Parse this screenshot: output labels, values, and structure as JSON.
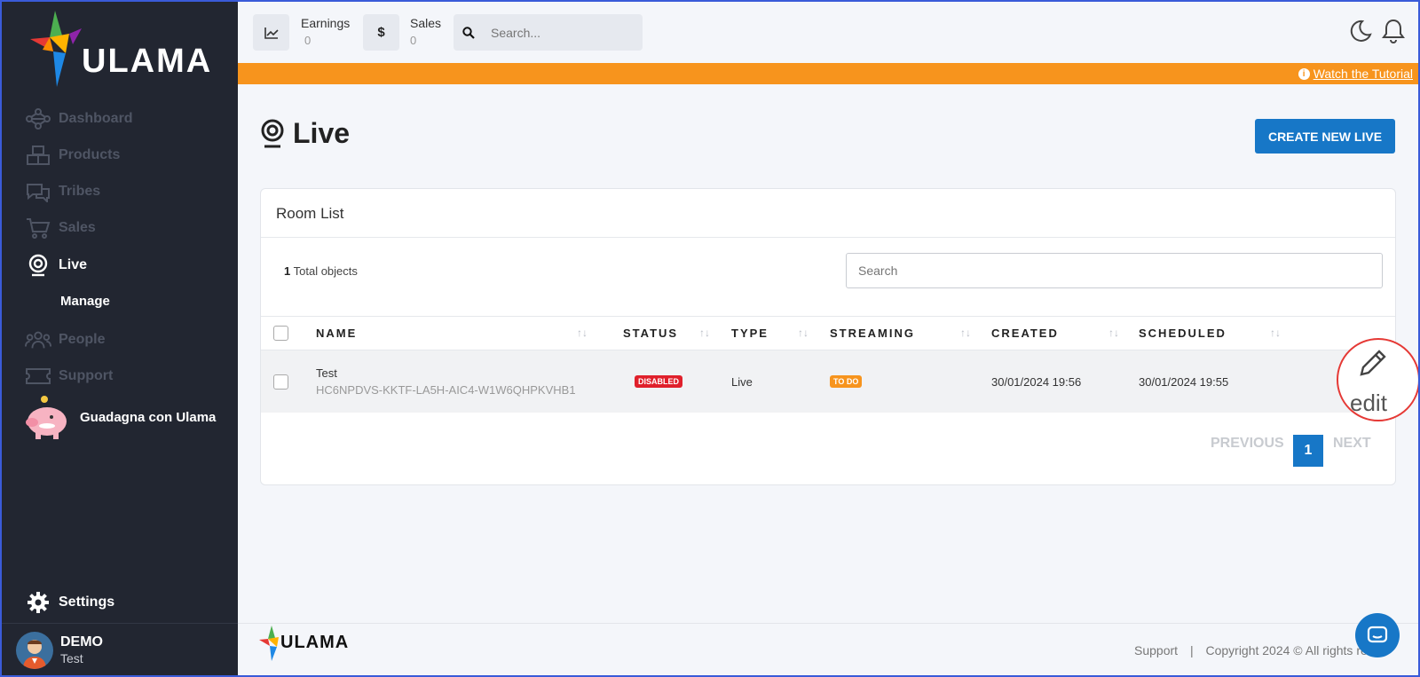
{
  "sidebar": {
    "logo": "ULAMA",
    "items": [
      {
        "label": "Dashboard"
      },
      {
        "label": "Products"
      },
      {
        "label": "Tribes"
      },
      {
        "label": "Sales"
      },
      {
        "label": "Live"
      },
      {
        "label": "People"
      },
      {
        "label": "Support"
      }
    ],
    "sub_item": "Manage",
    "promo": "Guadagna con Ulama",
    "settings": "Settings",
    "user": {
      "name": "DEMO",
      "sub": "Test"
    }
  },
  "topbar": {
    "earnings_label": "Earnings",
    "earnings_value": "0",
    "sales_label": "Sales",
    "sales_value": "0",
    "search_placeholder": "Search..."
  },
  "banner": {
    "link": "Watch the Tutorial"
  },
  "page": {
    "title": "Live",
    "create_button": "CREATE NEW LIVE"
  },
  "card": {
    "title": "Room List",
    "total_count": "1",
    "total_label": "Total objects",
    "search_placeholder": "Search",
    "columns": [
      "NAME",
      "STATUS",
      "TYPE",
      "STREAMING",
      "CREATED",
      "SCHEDULED"
    ],
    "rows": [
      {
        "name": "Test",
        "code": "HC6NPDVS-KKTF-LA5H-AIC4-W1W6QHPKVHB1",
        "status": "DISABLED",
        "type": "Live",
        "streaming": "TO DO",
        "created": "30/01/2024 19:56",
        "scheduled": "30/01/2024 19:55"
      }
    ],
    "pager": {
      "previous": "PREVIOUS",
      "current": "1",
      "next": "NEXT"
    }
  },
  "overlay": {
    "edit_label": "edit"
  },
  "footer": {
    "logo": "ULAMA",
    "support": "Support",
    "separator": "|",
    "copyright": "Copyright 2024 © All rights res"
  },
  "colors": {
    "sidebar_bg": "#222631",
    "accent": "#1777c7",
    "banner": "#f7941d",
    "disabled_badge": "#e0202b",
    "todo_badge": "#f7941d"
  }
}
